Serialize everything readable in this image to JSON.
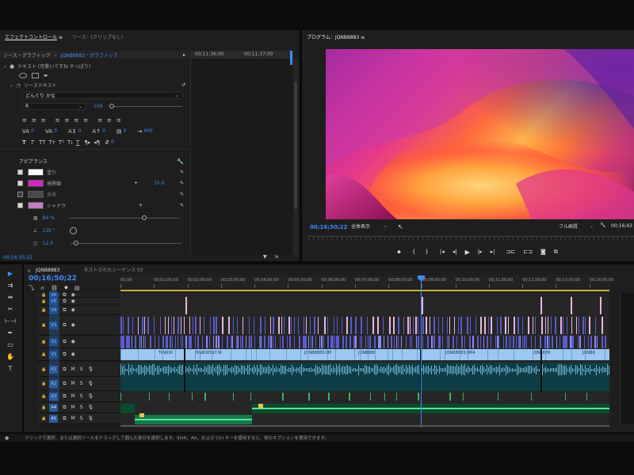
{
  "effect_controls": {
    "tab_label": "エフェクトコントロール",
    "tab_menu": "≡",
    "source_tab": "ソース：(クリップなし)",
    "source_path": "ソース・グラフィック",
    "sequence_path": "JQNB8883・グラフィック",
    "tc_left": "00;11;36;00",
    "tc_right": "00;11;37;00",
    "text_layer": "テキスト (可愛いですね やっぱり)",
    "source_text_label": "ソーステキスト",
    "font_name": "どんぐり かな",
    "font_style": "R",
    "font_size": "100",
    "kerning_value": "0",
    "tracking_value": "0",
    "leading_value": "0",
    "baseline_value": "0",
    "tsume_value": "0",
    "tab_width_value": "400",
    "small_caps_value": "0",
    "appearance_label": "アピアランス",
    "fill_label": "塗り",
    "stroke_label": "境界線",
    "stroke_value": "15.0",
    "background_label": "背景",
    "shadow_label": "シャドウ",
    "opacity_value": "84 %",
    "angle_value": "135 °",
    "distance_value": "12.5",
    "footer_tc": "00;16;50;22"
  },
  "program_monitor": {
    "tab_label": "プログラム：JQNB8883",
    "tab_menu": "≡",
    "current_tc": "00;16;50;22",
    "fit_select": "全体表示",
    "quality_select": "フル画質",
    "duration_tc": "00;16;43"
  },
  "timeline": {
    "close_icon": "×",
    "seq_tab": "JQNB8883",
    "nested_tab": "ネストされたシーケンス 03",
    "timecode": "00;16;50;22",
    "ruler_labels": [
      "00;00",
      "00;01;00;00",
      "00;02;00;00",
      "00;03;00;00",
      "00;04;00;00",
      "00;05;00;00",
      "00;06;00;00",
      "00;07;00;00",
      "00;08;00;00",
      "00;09;00;00",
      "00;10;00;00",
      "00;11;00;00",
      "00;12;00;00",
      "00;13;00;00",
      "00;14;00;00"
    ],
    "video_tracks": [
      "V6",
      "V5",
      "V4",
      "V3",
      "V2",
      "V1"
    ],
    "audio_tracks": [
      "A1",
      "A2",
      "A3",
      "A4",
      "A5"
    ],
    "clip_labels": [
      "TKWD0",
      "TKWD0597.M",
      "JQNB8883.MP",
      "JQNB888",
      "JQNB8883.MP4",
      "JQNB888",
      "JQNB8"
    ],
    "m_label": "M",
    "s_label": "S"
  },
  "status_bar": {
    "text": "クリックで選択、または選択ツールをドラッグして囲んだ部分を選択します。Shift、Alt、および Ctrl キーを使用すると、他のオプションを使用できます。"
  },
  "colors": {
    "accent_blue": "#3d8bf5",
    "video_clip": "#9ac8f0",
    "video_clip_dark": "#5b5bd0",
    "audio_clip": "#1f8a5a",
    "pink_clip": "#e7b6dd",
    "stroke_color": "#d923c8",
    "shadow_color": "#c27cc4"
  }
}
